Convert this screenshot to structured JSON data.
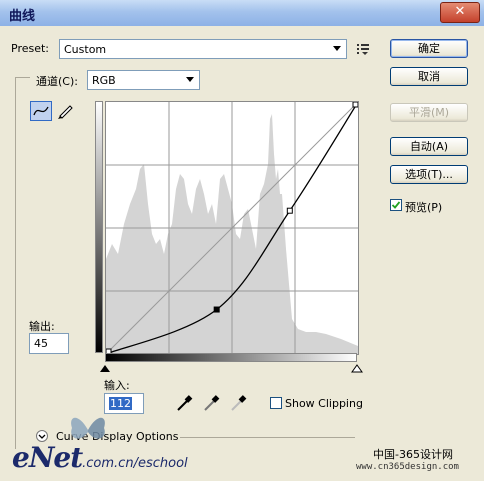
{
  "window": {
    "title": "曲线",
    "close_glyph": "✕"
  },
  "preset": {
    "label": "Preset:",
    "value": "Custom",
    "menu_icon": "list-options-icon"
  },
  "channel": {
    "label": "通道(C):",
    "value": "RGB"
  },
  "buttons": {
    "ok": "确定",
    "cancel": "取消",
    "smooth": "平滑(M)",
    "auto": "自动(A)",
    "options": "选项(T)...",
    "preview_label": "预览(P)"
  },
  "preview_checked": true,
  "output": {
    "label": "输出:",
    "value": "45"
  },
  "input": {
    "label": "输入:",
    "value": "112"
  },
  "show_clipping": {
    "label": "Show Clipping",
    "checked": false
  },
  "curve_display": {
    "label": "Curve Display Options",
    "icon": "chevron-down-icon"
  },
  "curve_points": [
    [
      0,
      0
    ],
    [
      112,
      45
    ],
    [
      186,
      145
    ],
    [
      255,
      255
    ]
  ],
  "colors": {
    "accent": "#316ac5",
    "histogram": "#d4d4d4",
    "curve": "#000000"
  },
  "watermark": {
    "logo": "eNet",
    "site": ".com.cn/eschool",
    "cn_text": "中国-365设计网",
    "cn_url": "www.cn365design.com"
  }
}
